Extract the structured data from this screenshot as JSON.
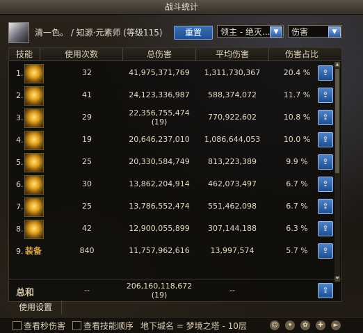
{
  "window": {
    "title": "战斗统计"
  },
  "header": {
    "character": "清一色。 / 知源·元素师 (等级115)",
    "reset_label": "重置",
    "mode_select": "领主 - 绝灭...",
    "metric_select": "伤害"
  },
  "table": {
    "columns": [
      "技能",
      "使用次数",
      "总伤害",
      "平均伤害",
      "伤害占比"
    ],
    "rows": [
      {
        "index": "1.",
        "icon": "skill-icon-1",
        "uses": "32",
        "total": "41,975,371,769",
        "total_extra": "",
        "avg": "1,311,730,367",
        "pct": "20.4 %"
      },
      {
        "index": "2.",
        "icon": "skill-icon-2",
        "uses": "41",
        "total": "24,123,336,987",
        "total_extra": "",
        "avg": "588,374,072",
        "pct": "11.7 %"
      },
      {
        "index": "3.",
        "icon": "skill-icon-3",
        "uses": "29",
        "total": "22,356,755,474",
        "total_extra": "(19)",
        "avg": "770,922,602",
        "pct": "10.8 %"
      },
      {
        "index": "4.",
        "icon": "skill-icon-4",
        "uses": "19",
        "total": "20,646,237,010",
        "total_extra": "",
        "avg": "1,086,644,053",
        "pct": "10.0 %"
      },
      {
        "index": "5.",
        "icon": "skill-icon-5",
        "uses": "25",
        "total": "20,330,584,749",
        "total_extra": "",
        "avg": "813,223,389",
        "pct": "9.9 %"
      },
      {
        "index": "6.",
        "icon": "skill-icon-6",
        "uses": "30",
        "total": "13,862,204,914",
        "total_extra": "",
        "avg": "462,073,497",
        "pct": "6.7 %"
      },
      {
        "index": "7.",
        "icon": "skill-icon-7",
        "uses": "25",
        "total": "13,786,552,474",
        "total_extra": "",
        "avg": "551,462,098",
        "pct": "6.7 %"
      },
      {
        "index": "8.",
        "icon": "skill-icon-8",
        "uses": "42",
        "total": "12,900,055,899",
        "total_extra": "",
        "avg": "307,144,188",
        "pct": "6.3 %"
      },
      {
        "index": "9.",
        "icon": "equip",
        "equip_label": "装备",
        "uses": "840",
        "total": "11,757,962,616",
        "total_extra": "",
        "avg": "13,997,574",
        "pct": "5.7 %"
      }
    ],
    "summary": {
      "label": "总和",
      "uses": "--",
      "total": "206,160,118,672",
      "total_extra": "(19)",
      "avg": "--"
    }
  },
  "settings_tab": "使用设置",
  "footer": {
    "check_second_damage": "查看秒伤害",
    "check_skill_order": "查看技能顺序",
    "dungeon": "地下城名 = 梦境之塔 - 10层"
  },
  "colors": {
    "accent_button": "#2a5ea3",
    "gold": "#e0a640",
    "panel": "#0e0c0a"
  }
}
